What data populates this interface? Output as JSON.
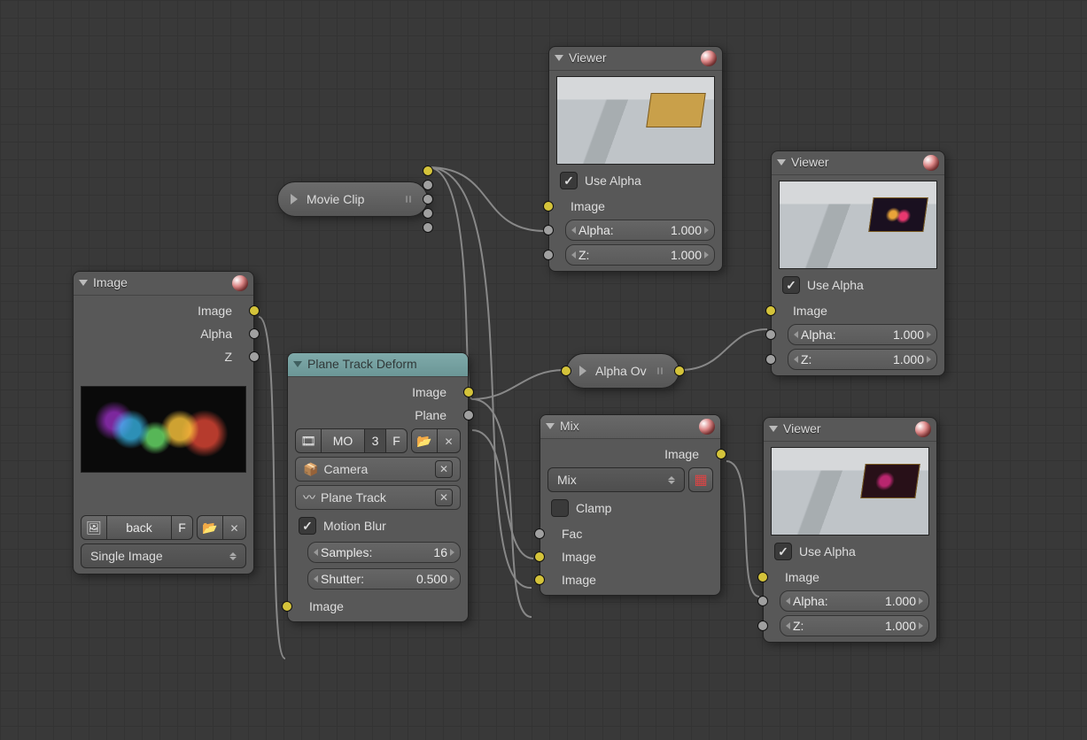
{
  "movie_clip": {
    "title": "Movie Clip"
  },
  "alpha_over": {
    "title": "Alpha Ov"
  },
  "image_node": {
    "title": "Image",
    "out_image": "Image",
    "out_alpha": "Alpha",
    "out_z": "Z",
    "back_label": "back",
    "f_label": "F",
    "single_image": "Single Image"
  },
  "plane_track": {
    "title": "Plane Track Deform",
    "out_image": "Image",
    "out_plane": "Plane",
    "mo_label": "MO",
    "count_label": "3",
    "f_label": "F",
    "camera": "Camera",
    "plane": "Plane Track",
    "motion_blur": "Motion Blur",
    "samples_label": "Samples:",
    "samples_value": "16",
    "shutter_label": "Shutter:",
    "shutter_value": "0.500",
    "in_image": "Image"
  },
  "viewer1": {
    "title": "Viewer",
    "use_alpha": "Use Alpha",
    "in_image": "Image",
    "alpha_label": "Alpha:",
    "alpha_value": "1.000",
    "z_label": "Z:",
    "z_value": "1.000"
  },
  "viewer2": {
    "title": "Viewer",
    "use_alpha": "Use Alpha",
    "in_image": "Image",
    "alpha_label": "Alpha:",
    "alpha_value": "1.000",
    "z_label": "Z:",
    "z_value": "1.000"
  },
  "viewer3": {
    "title": "Viewer",
    "use_alpha": "Use Alpha",
    "in_image": "Image",
    "alpha_label": "Alpha:",
    "alpha_value": "1.000",
    "z_label": "Z:",
    "z_value": "1.000"
  },
  "mix": {
    "title": "Mix",
    "out_image": "Image",
    "mode": "Mix",
    "clamp": "Clamp",
    "in_fac": "Fac",
    "in_image1": "Image",
    "in_image2": "Image"
  }
}
